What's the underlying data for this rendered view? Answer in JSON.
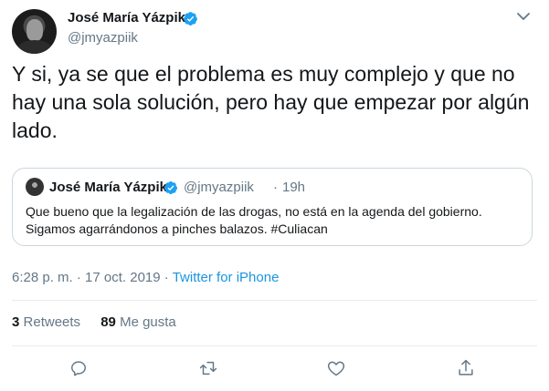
{
  "author": {
    "name": "José María Yázpik",
    "handle": "@jmyazpiik"
  },
  "tweet": {
    "text": "Y si, ya se que el problema es muy complejo y que no hay una sola solución, pero hay que empezar por algún lado."
  },
  "quoted": {
    "name": "José María Yázpik",
    "handle": "@jmyazpiik",
    "dot": "·",
    "time": "19h",
    "text": "Que bueno que la legalización de las drogas, no está en la agenda del gobierno. Sigamos agarrándonos a pinches balazos. #Culiacan"
  },
  "meta": {
    "time": "6:28 p. m.",
    "separator1": "·",
    "date": "17 oct. 2019",
    "separator2": "·",
    "source": "Twitter for iPhone"
  },
  "stats": {
    "retweets_count": "3",
    "retweets_label": "Retweets",
    "likes_count": "89",
    "likes_label": "Me gusta"
  },
  "icons": {
    "verified": "verified-badge-icon",
    "more": "chevron-down-icon",
    "reply": "reply-icon",
    "retweet": "retweet-icon",
    "like": "heart-icon",
    "share": "share-icon"
  },
  "colors": {
    "text": "#14171a",
    "secondary": "#657786",
    "link": "#1b95e0",
    "verified": "#1da1f2",
    "border": "#ccd6dd",
    "divider": "#e6ecf0"
  }
}
